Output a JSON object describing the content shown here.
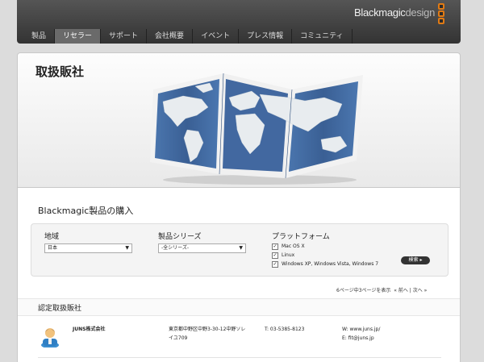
{
  "brand": {
    "name_bold": "Blackmagic",
    "name_light": "design"
  },
  "nav": {
    "items": [
      {
        "label": "製品"
      },
      {
        "label": "リセラー"
      },
      {
        "label": "サポート"
      },
      {
        "label": "会社概要"
      },
      {
        "label": "イベント"
      },
      {
        "label": "プレス情報"
      },
      {
        "label": "コミュニティ"
      }
    ],
    "active_index": 1
  },
  "hero": {
    "title": "取扱販社"
  },
  "buy": {
    "title": "Blackmagic製品の購入"
  },
  "filters": {
    "region_label": "地域",
    "region_value": "日本",
    "series_label": "製品シリーズ",
    "series_value": "-全シリーズ-",
    "platform_label": "プラットフォーム",
    "platforms": [
      {
        "label": "Mac OS X",
        "checked": true
      },
      {
        "label": "Linux",
        "checked": true
      },
      {
        "label": "Windows XP, Windows Vista, Windows 7",
        "checked": true
      }
    ],
    "search_label": "検索 ▸"
  },
  "pager": {
    "text": "6ページ中3ページを表示",
    "prev": "« 前へ",
    "sep": "|",
    "next": "次へ »"
  },
  "section": {
    "title": "認定取扱販社"
  },
  "dealer": {
    "name": "JUNS株式会社",
    "address_line1": "東京都中野区中野3-30-12中野ソレ",
    "address_line2": "イユ709",
    "tel": "T: 03-5385-8123",
    "web": "W: www.juns.jp/",
    "email": "E: fit@juns.jp"
  },
  "colors": {
    "accent": "#e07a14",
    "header": "#3a3a3a",
    "map_blue": "#3f6aa3"
  }
}
